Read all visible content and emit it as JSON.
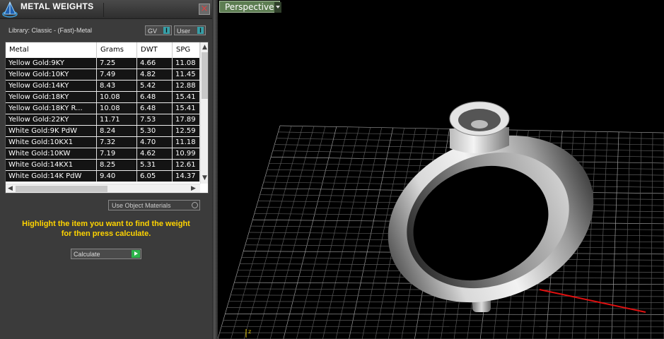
{
  "panel": {
    "title": "METAL WEIGHTS",
    "close_glyph": "×",
    "library_label": "Library: Classic - (Fast)-Metal",
    "gv_label": "GV",
    "user_label": "User",
    "toggle_glyph": "I"
  },
  "table": {
    "columns": [
      "Metal",
      "Grams",
      "DWT",
      "SPG"
    ],
    "rows": [
      [
        "Yellow Gold:9KY",
        "7.25",
        "4.66",
        "11.08"
      ],
      [
        "Yellow Gold:10KY",
        "7.49",
        "4.82",
        "11.45"
      ],
      [
        "Yellow Gold:14KY",
        "8.43",
        "5.42",
        "12.88"
      ],
      [
        "Yellow Gold:18KY",
        "10.08",
        "6.48",
        "15.41"
      ],
      [
        "Yellow Gold:18KY R...",
        "10.08",
        "6.48",
        "15.41"
      ],
      [
        "Yellow Gold:22KY",
        "11.71",
        "7.53",
        "17.89"
      ],
      [
        "White Gold:9K PdW",
        "8.24",
        "5.30",
        "12.59"
      ],
      [
        "White Gold:10KX1",
        "7.32",
        "4.70",
        "11.18"
      ],
      [
        "White Gold:10KW",
        "7.19",
        "4.62",
        "10.99"
      ],
      [
        "White Gold:14KX1",
        "8.25",
        "5.31",
        "12.61"
      ],
      [
        "White Gold:14K PdW",
        "9.40",
        "6.05",
        "14.37"
      ]
    ]
  },
  "options": {
    "use_object_materials": "Use Object Materials"
  },
  "hint": {
    "line1": "Highlight the item you want to find the weight",
    "line2": "for then press calculate."
  },
  "calculate_label": "Calculate",
  "viewport": {
    "view_name": "Perspective",
    "axis_colors": {
      "x": "#e01010",
      "y": "#10c0d0",
      "z": "#e0c000"
    }
  },
  "colors": {
    "panel_bg": "#3b3b3b",
    "hint": "#ffd400",
    "view_label_bg": "#5d7d52"
  }
}
